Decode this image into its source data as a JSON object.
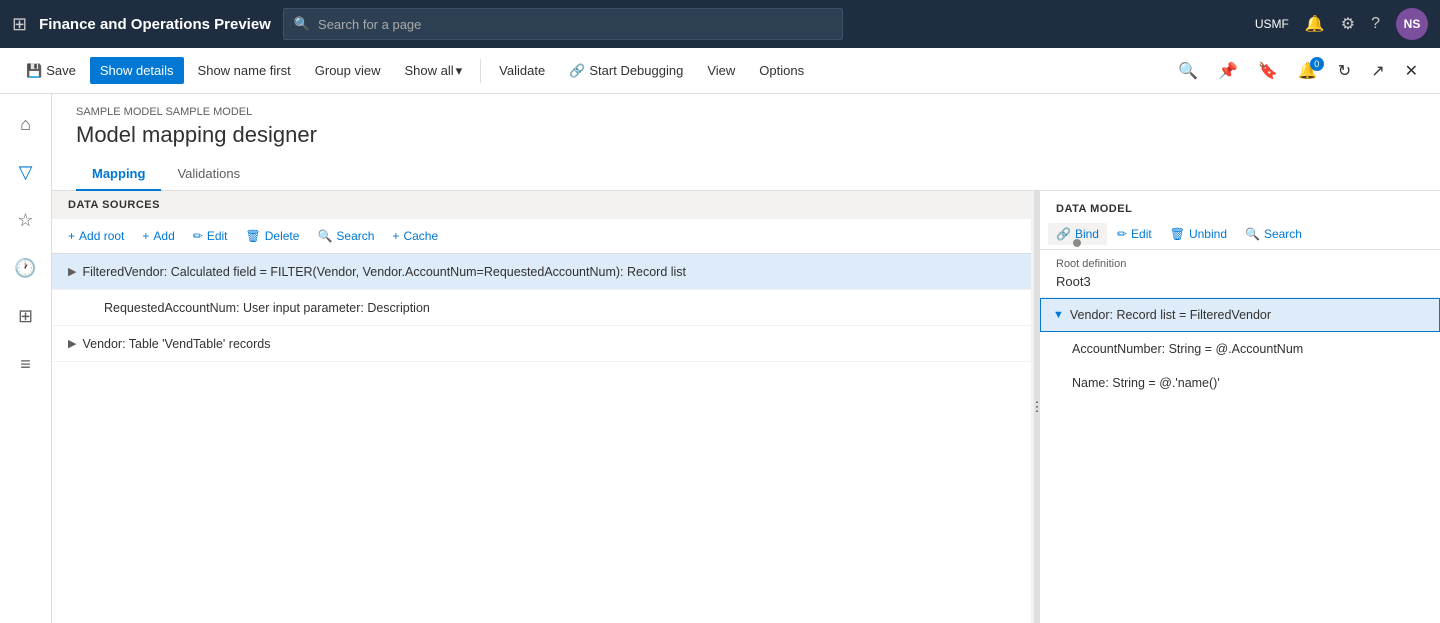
{
  "app": {
    "title": "Finance and Operations Preview",
    "company": "USMF",
    "user_initials": "NS"
  },
  "search_bar": {
    "placeholder": "Search for a page"
  },
  "toolbar": {
    "save_label": "Save",
    "show_details_label": "Show details",
    "show_name_first_label": "Show name first",
    "group_view_label": "Group view",
    "show_all_label": "Show all",
    "validate_label": "Validate",
    "start_debugging_label": "Start Debugging",
    "view_label": "View",
    "options_label": "Options"
  },
  "breadcrumb": "SAMPLE MODEL SAMPLE MODEL",
  "page_title": "Model mapping designer",
  "tabs": [
    {
      "id": "mapping",
      "label": "Mapping",
      "active": true
    },
    {
      "id": "validations",
      "label": "Validations",
      "active": false
    }
  ],
  "left_panel": {
    "header": "DATA SOURCES",
    "toolbar_items": [
      {
        "id": "add-root",
        "label": "Add root"
      },
      {
        "id": "add",
        "label": "Add"
      },
      {
        "id": "edit",
        "label": "Edit"
      },
      {
        "id": "delete",
        "label": "Delete"
      },
      {
        "id": "search",
        "label": "Search"
      },
      {
        "id": "cache",
        "label": "Cache"
      }
    ],
    "items": [
      {
        "id": "filtered-vendor",
        "level": 0,
        "expandable": true,
        "expanded": false,
        "selected": true,
        "text": "FilteredVendor: Calculated field = FILTER(Vendor, Vendor.AccountNum=RequestedAccountNum): Record list"
      },
      {
        "id": "requested-account-num",
        "level": 1,
        "expandable": false,
        "expanded": false,
        "selected": false,
        "text": "RequestedAccountNum: User input parameter: Description"
      },
      {
        "id": "vendor",
        "level": 0,
        "expandable": true,
        "expanded": false,
        "selected": false,
        "text": "Vendor: Table 'VendTable' records"
      }
    ]
  },
  "right_panel": {
    "section_label": "DATA MODEL",
    "actions": [
      {
        "id": "bind",
        "label": "Bind"
      },
      {
        "id": "edit",
        "label": "Edit"
      },
      {
        "id": "unbind",
        "label": "Unbind"
      },
      {
        "id": "search",
        "label": "Search"
      }
    ],
    "root_definition_label": "Root definition",
    "root_definition_value": "Root3",
    "items": [
      {
        "id": "vendor-record",
        "level": 0,
        "expandable": true,
        "expanded": true,
        "selected": true,
        "text": "Vendor: Record list = FilteredVendor"
      },
      {
        "id": "account-number",
        "level": 1,
        "expandable": false,
        "selected": false,
        "text": "AccountNumber: String = @.AccountNum"
      },
      {
        "id": "name",
        "level": 1,
        "expandable": false,
        "selected": false,
        "text": "Name: String = @.'name()'"
      }
    ]
  }
}
